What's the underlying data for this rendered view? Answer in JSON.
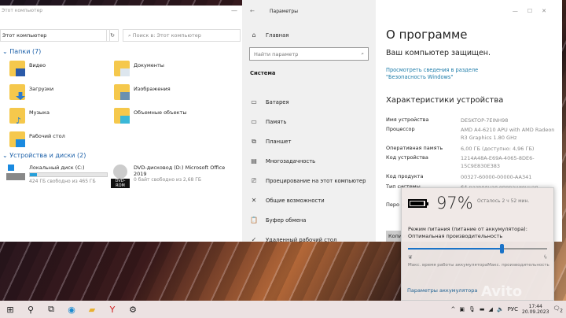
{
  "explorer": {
    "title": "Этот компьютер",
    "address": "Этот компьютер",
    "search_placeholder": "Поиск в: Этот компьютер",
    "folders_header": "Папки (7)",
    "folders": [
      {
        "label": "Видео"
      },
      {
        "label": "Документы"
      },
      {
        "label": "Загрузки"
      },
      {
        "label": "Изображения"
      },
      {
        "label": "Музыка"
      },
      {
        "label": "Объемные объекты"
      },
      {
        "label": "Рабочий стол"
      }
    ],
    "devices_header": "Устройства и диски (2)",
    "drives": [
      {
        "label": "Локальный диск (C:)",
        "free": "424 ГБ свободно из 465 ГБ",
        "used_fraction": 0.088
      },
      {
        "label": "DVD-дисковод (D:) Microsoft Office 2019",
        "badge": "DVD-ROM",
        "free": "0 байт свободно из 2,68 ГБ"
      }
    ]
  },
  "settings": {
    "title": "Параметры",
    "home": "Главная",
    "search_placeholder": "Найти параметр",
    "section": "Система",
    "nav": [
      {
        "label": "Батарея",
        "icon": "battery-icon"
      },
      {
        "label": "Память",
        "icon": "storage-icon"
      },
      {
        "label": "Планшет",
        "icon": "tablet-icon"
      },
      {
        "label": "Многозадачность",
        "icon": "multitasking-icon"
      },
      {
        "label": "Проецирование на этот компьютер",
        "icon": "projecting-icon"
      },
      {
        "label": "Общие возможности",
        "icon": "shared-icon"
      },
      {
        "label": "Буфер обмена",
        "icon": "clipboard-icon"
      },
      {
        "label": "Удаленный рабочий стол",
        "icon": "remote-desktop-icon"
      }
    ],
    "page_title": "О программе",
    "protected": "Ваш компьютер защищен.",
    "security_link": "Просмотреть сведения в разделе \"Безопасность Windows\"",
    "specs_title": "Характеристики устройства",
    "specs": [
      {
        "k": "Имя устройства",
        "v": "DESKTOP-7EINH98"
      },
      {
        "k": "Процессор",
        "v": "AMD A4-6210 APU with AMD Radeon R3 Graphics      1.80 GHz"
      },
      {
        "k": "Оперативная память",
        "v": "6,00 ГБ (доступно: 4,96 ГБ)"
      },
      {
        "k": "Код устройства",
        "v": "1214A48A-E69A-4065-8DE6-15C9E830E383"
      },
      {
        "k": "Код продукта",
        "v": "00327-60000-00000-AA341"
      },
      {
        "k": "Тип системы",
        "v": "64-разрядная операционная"
      },
      {
        "k": "Перо и",
        "v": ""
      }
    ],
    "copy_button": "Копировать"
  },
  "battery": {
    "percent": "97%",
    "level": 0.97,
    "remaining": "Осталось 2 ч 52 мин.",
    "mode_label": "Режим питания (питание от аккумулятора):",
    "mode_value": "Оптимальная производительность",
    "slider_value": 0.67,
    "min_label": "Макс. время работы аккумулятора",
    "max_label": "Макс. производительность",
    "settings_link": "Параметры аккумулятора"
  },
  "taskbar": {
    "lang": "РУС",
    "time": "17:44",
    "date": "20.09.2023",
    "notifications": "2"
  },
  "watermark": "Avito"
}
